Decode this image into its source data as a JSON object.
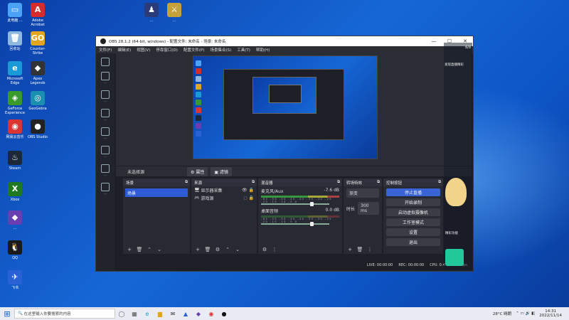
{
  "desktop": {
    "icons": [
      {
        "label": "此电脑 ...",
        "color": "#4aa3f5",
        "glyph": "▭"
      },
      {
        "label": "Adobe Acrobat",
        "color": "#d62b2b",
        "glyph": "A"
      },
      {
        "label": "回收站",
        "color": "#8fb8e0",
        "glyph": "🗑"
      },
      {
        "label": "Counter-Strike",
        "color": "#e3a51c",
        "glyph": "GO"
      },
      {
        "label": "Microsoft Edge",
        "color": "#1a9bd7",
        "glyph": "e"
      },
      {
        "label": "Apex Legends",
        "color": "#333",
        "glyph": "◆"
      },
      {
        "label": "GeForce Experience",
        "color": "#3a9b2b",
        "glyph": "◈"
      },
      {
        "label": "GeoGebra",
        "color": "#1a8fb0",
        "glyph": "◎"
      },
      {
        "label": "网易云音乐",
        "color": "#d33",
        "glyph": "◉"
      },
      {
        "label": "OBS Studio",
        "color": "#222",
        "glyph": "●"
      },
      {
        "label": "Steam",
        "color": "#1b2838",
        "glyph": "♨"
      },
      {
        "label": "Xbox",
        "color": "#1f7a1f",
        "glyph": "X"
      },
      {
        "label": "...",
        "color": "#6a3db0",
        "glyph": "◆"
      },
      {
        "label": "QQ",
        "color": "#1a1a1a",
        "glyph": "🐧"
      },
      {
        "label": "飞书",
        "color": "#2a62d6",
        "glyph": "✈"
      }
    ],
    "top_icons": [
      {
        "label": "...",
        "color": "#2b3a78",
        "glyph": "♟"
      },
      {
        "label": "...",
        "color": "#c4a237",
        "glyph": "⚔"
      }
    ]
  },
  "obs": {
    "title": "OBS 28.1.2 (64-bit, windows) - 配置文件: 未命名 - 场景: 未命名",
    "menu": [
      "文件(F)",
      "编辑(E)",
      "视图(V)",
      "停靠窗口(D)",
      "配置文件(P)",
      "场景集合(S)",
      "工具(T)",
      "帮助(H)"
    ],
    "sidebar": [
      "...",
      "...",
      "...",
      "...",
      "...",
      "...",
      "..."
    ],
    "sources_bar": {
      "no_source": "未选择源",
      "props": "属性",
      "filters": "滤镜"
    },
    "scenes": {
      "title": "场景",
      "items": [
        "场景"
      ]
    },
    "sources": {
      "title": "来源",
      "items": [
        {
          "label": "显示器采集"
        },
        {
          "label": "游戏源"
        }
      ]
    },
    "mixer": {
      "title": "混音器",
      "channels": [
        {
          "name": "麦克风/Aux",
          "db": "-7.6 dB"
        },
        {
          "name": "桌面音频",
          "db": "0.0 dB"
        }
      ],
      "ticks": "-60 -55 -50 -45 -40 -35 -30 -25 -20 -15 -10 -5 0"
    },
    "transitions": {
      "title": "转场特效",
      "type": "渐变",
      "duration_label": "时长",
      "duration": "300 ms"
    },
    "controls": {
      "title": "控制按钮",
      "buttons": [
        "停止直播",
        "开始录制",
        "启动虚拟摄像机",
        "工作室模式",
        "设置",
        "退出"
      ]
    },
    "status": {
      "live": "LIVE: 00:00:00",
      "rec": "REC: 00:00:00",
      "cpu": "CPU: 0.4%, 60.00 fps"
    }
  },
  "right_panel": {
    "top_text": "8/8",
    "mid_text": "发现直播精彩",
    "bottom_text": "精彩功能"
  },
  "taskbar": {
    "search_placeholder": "在这里输入你要搜索的内容",
    "weather": "28°C 晴朗",
    "time": "14:31",
    "date": "2022/11/14"
  }
}
